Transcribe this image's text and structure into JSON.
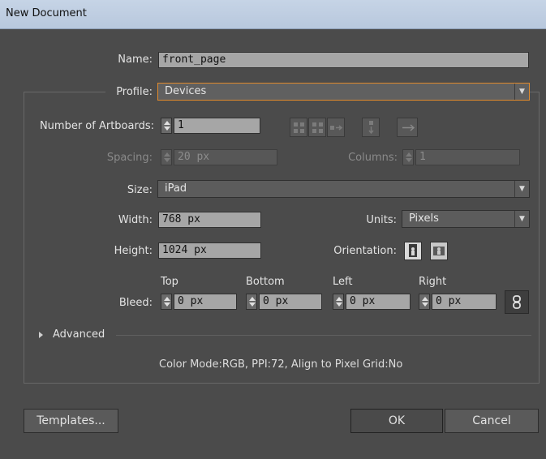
{
  "window": {
    "title": "New Document"
  },
  "fields": {
    "name": {
      "label": "Name:",
      "value": "front_page"
    },
    "profile": {
      "label": "Profile:",
      "value": "Devices"
    },
    "artboards": {
      "label": "Number of Artboards:",
      "value": "1"
    },
    "spacing": {
      "label": "Spacing:",
      "value": "20 px"
    },
    "columns": {
      "label": "Columns:",
      "value": "1"
    },
    "size": {
      "label": "Size:",
      "value": "iPad"
    },
    "width": {
      "label": "Width:",
      "value": "768 px"
    },
    "units": {
      "label": "Units:",
      "value": "Pixels"
    },
    "height": {
      "label": "Height:",
      "value": "1024 px"
    },
    "orientation": {
      "label": "Orientation:",
      "selected": "portrait"
    }
  },
  "bleed": {
    "label": "Bleed:",
    "top": {
      "label": "Top",
      "value": "0 px"
    },
    "bottom": {
      "label": "Bottom",
      "value": "0 px"
    },
    "left": {
      "label": "Left",
      "value": "0 px"
    },
    "right": {
      "label": "Right",
      "value": "0 px"
    }
  },
  "advanced": {
    "label": "Advanced"
  },
  "summary": "Color Mode:RGB, PPI:72, Align to Pixel Grid:No",
  "buttons": {
    "templates": "Templates...",
    "ok": "OK",
    "cancel": "Cancel"
  },
  "icons": {
    "artboard_layouts": [
      "grid-by-row-icon",
      "grid-by-column-icon",
      "arrange-by-row-icon",
      "arrange-by-column-icon",
      "right-to-left-icon"
    ],
    "orientation": [
      "portrait-icon",
      "landscape-icon"
    ],
    "bleed_link": "chain-link-icon",
    "advanced": "disclosure-triangle-icon"
  },
  "colors": {
    "background": "#4b4b4b",
    "focus_border": "#e08a2c",
    "titlebar": "#b8c8dd"
  }
}
